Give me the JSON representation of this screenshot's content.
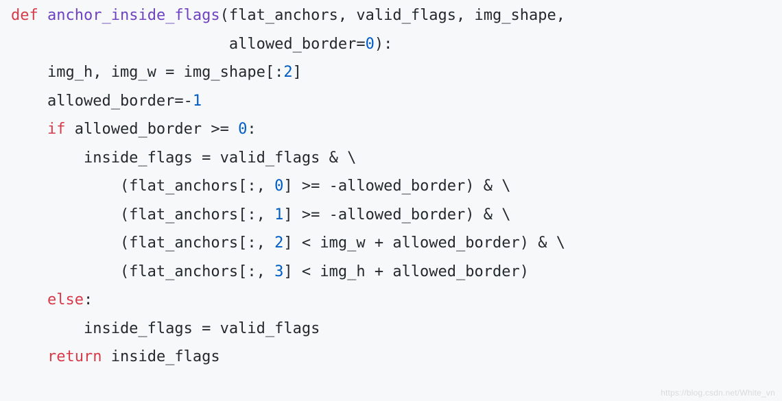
{
  "code": {
    "tokens": [
      {
        "cls": "tok-keyword",
        "text": "def"
      },
      {
        "cls": "",
        "text": " "
      },
      {
        "cls": "tok-funcname",
        "text": "anchor_inside_flags"
      },
      {
        "cls": "tok-punct",
        "text": "(flat_anchors, valid_flags, img_shape,\n                        allowed_border"
      },
      {
        "cls": "tok-operator",
        "text": "="
      },
      {
        "cls": "tok-number",
        "text": "0"
      },
      {
        "cls": "tok-punct",
        "text": "):\n    img_h, img_w "
      },
      {
        "cls": "tok-operator",
        "text": "="
      },
      {
        "cls": "tok-punct",
        "text": " img_shape[:"
      },
      {
        "cls": "tok-number",
        "text": "2"
      },
      {
        "cls": "tok-punct",
        "text": "]\n    allowed_border"
      },
      {
        "cls": "tok-operator",
        "text": "=-"
      },
      {
        "cls": "tok-number",
        "text": "1"
      },
      {
        "cls": "tok-punct",
        "text": "\n    "
      },
      {
        "cls": "tok-keyword",
        "text": "if"
      },
      {
        "cls": "tok-punct",
        "text": " allowed_border "
      },
      {
        "cls": "tok-operator",
        "text": ">="
      },
      {
        "cls": "tok-punct",
        "text": " "
      },
      {
        "cls": "tok-number",
        "text": "0"
      },
      {
        "cls": "tok-punct",
        "text": ":\n        inside_flags "
      },
      {
        "cls": "tok-operator",
        "text": "="
      },
      {
        "cls": "tok-punct",
        "text": " valid_flags "
      },
      {
        "cls": "tok-operator",
        "text": "&"
      },
      {
        "cls": "tok-punct",
        "text": " \\\n            (flat_anchors[:, "
      },
      {
        "cls": "tok-number",
        "text": "0"
      },
      {
        "cls": "tok-punct",
        "text": "] "
      },
      {
        "cls": "tok-operator",
        "text": ">="
      },
      {
        "cls": "tok-punct",
        "text": " "
      },
      {
        "cls": "tok-operator",
        "text": "-"
      },
      {
        "cls": "tok-punct",
        "text": "allowed_border) "
      },
      {
        "cls": "tok-operator",
        "text": "&"
      },
      {
        "cls": "tok-punct",
        "text": " \\\n            (flat_anchors[:, "
      },
      {
        "cls": "tok-number",
        "text": "1"
      },
      {
        "cls": "tok-punct",
        "text": "] "
      },
      {
        "cls": "tok-operator",
        "text": ">="
      },
      {
        "cls": "tok-punct",
        "text": " "
      },
      {
        "cls": "tok-operator",
        "text": "-"
      },
      {
        "cls": "tok-punct",
        "text": "allowed_border) "
      },
      {
        "cls": "tok-operator",
        "text": "&"
      },
      {
        "cls": "tok-punct",
        "text": " \\\n            (flat_anchors[:, "
      },
      {
        "cls": "tok-number",
        "text": "2"
      },
      {
        "cls": "tok-punct",
        "text": "] "
      },
      {
        "cls": "tok-operator",
        "text": "<"
      },
      {
        "cls": "tok-punct",
        "text": " img_w "
      },
      {
        "cls": "tok-operator",
        "text": "+"
      },
      {
        "cls": "tok-punct",
        "text": " allowed_border) "
      },
      {
        "cls": "tok-operator",
        "text": "&"
      },
      {
        "cls": "tok-punct",
        "text": " \\\n            (flat_anchors[:, "
      },
      {
        "cls": "tok-number",
        "text": "3"
      },
      {
        "cls": "tok-punct",
        "text": "] "
      },
      {
        "cls": "tok-operator",
        "text": "<"
      },
      {
        "cls": "tok-punct",
        "text": " img_h "
      },
      {
        "cls": "tok-operator",
        "text": "+"
      },
      {
        "cls": "tok-punct",
        "text": " allowed_border)\n    "
      },
      {
        "cls": "tok-keyword",
        "text": "else"
      },
      {
        "cls": "tok-punct",
        "text": ":\n        inside_flags "
      },
      {
        "cls": "tok-operator",
        "text": "="
      },
      {
        "cls": "tok-punct",
        "text": " valid_flags\n    "
      },
      {
        "cls": "tok-keyword",
        "text": "return"
      },
      {
        "cls": "tok-punct",
        "text": " inside_flags"
      }
    ]
  },
  "watermark": "https://blog.csdn.net/White_vn"
}
